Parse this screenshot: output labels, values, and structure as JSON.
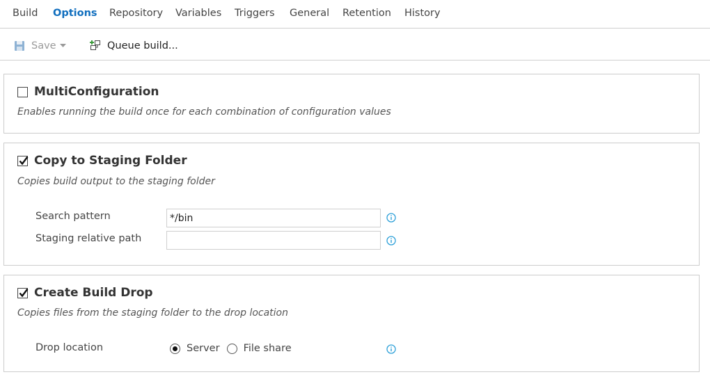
{
  "tabs": [
    {
      "label": "Build",
      "active": false
    },
    {
      "label": "Options",
      "active": true
    },
    {
      "label": "Repository",
      "active": false
    },
    {
      "label": "Variables",
      "active": false
    },
    {
      "label": "Triggers",
      "active": false
    },
    {
      "label": "General",
      "active": false
    },
    {
      "label": "Retention",
      "active": false
    },
    {
      "label": "History",
      "active": false
    }
  ],
  "toolbar": {
    "save_label": "Save",
    "save_icon": "floppy-disk-icon",
    "queue_label": "Queue build...",
    "queue_icon": "queue-build-icon"
  },
  "sections": {
    "multiconfig": {
      "title": "MultiConfiguration",
      "checked": false,
      "description": "Enables running the build once for each combination of configuration values"
    },
    "staging": {
      "title": "Copy to Staging Folder",
      "checked": true,
      "description": "Copies build output to the staging folder",
      "search_pattern_label": "Search pattern",
      "search_pattern_value": "*/bin",
      "relative_path_label": "Staging relative path",
      "relative_path_value": ""
    },
    "drop": {
      "title": "Create Build Drop",
      "checked": true,
      "description": "Copies files from the staging folder to the drop location",
      "drop_location_label": "Drop location",
      "options": [
        {
          "label": "Server",
          "selected": true
        },
        {
          "label": "File share",
          "selected": false
        }
      ]
    }
  },
  "colors": {
    "accent": "#106ebe",
    "info": "#2b9fd8",
    "border": "#cccccc"
  }
}
